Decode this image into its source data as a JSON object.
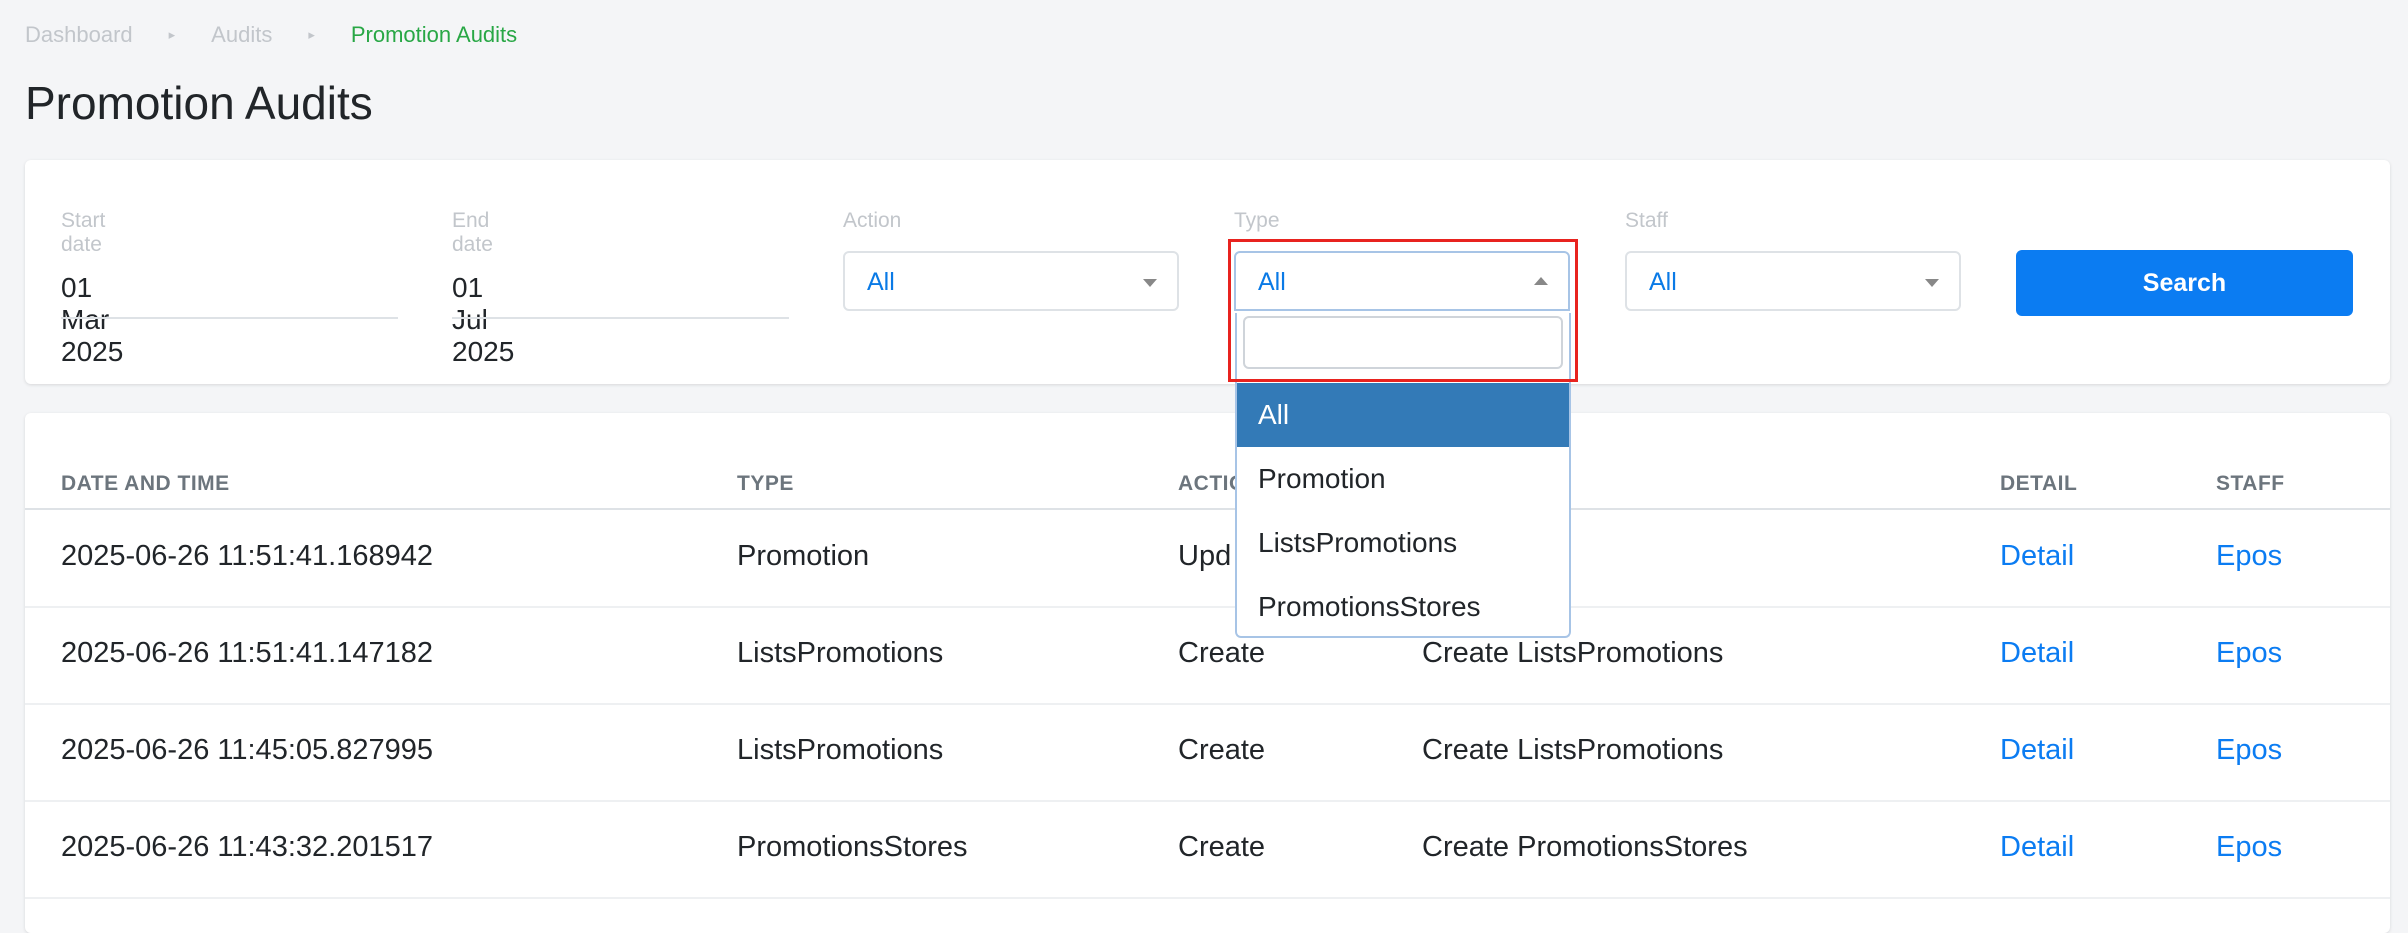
{
  "breadcrumb": {
    "items": [
      "Dashboard",
      "Audits",
      "Promotion Audits"
    ],
    "separator": "▸"
  },
  "page": {
    "title": "Promotion Audits"
  },
  "filters": {
    "start_date": {
      "label": "Start date",
      "value": "01 Mar 2025"
    },
    "end_date": {
      "label": "End date",
      "value": "01 Jul 2025"
    },
    "action": {
      "label": "Action",
      "value": "All"
    },
    "type": {
      "label": "Type",
      "value": "All",
      "open": true,
      "search_value": "",
      "options": [
        "All",
        "Promotion",
        "ListsPromotions",
        "PromotionsStores"
      ],
      "selected_option": "All"
    },
    "staff": {
      "label": "Staff",
      "value": "All"
    },
    "search_button": "Search"
  },
  "table": {
    "headers": {
      "date_time": "DATE AND TIME",
      "type": "TYPE",
      "action": "ACTIO",
      "detail": "DETAIL",
      "staff": "STAFF"
    },
    "rows": [
      {
        "date_time": "2025-06-26 11:51:41.168942",
        "type": "Promotion",
        "action": "Upd",
        "description": "",
        "detail": "Detail",
        "staff": "Epos"
      },
      {
        "date_time": "2025-06-26 11:51:41.147182",
        "type": "ListsPromotions",
        "action": "Create",
        "description": "Create ListsPromotions",
        "detail": "Detail",
        "staff": "Epos"
      },
      {
        "date_time": "2025-06-26 11:45:05.827995",
        "type": "ListsPromotions",
        "action": "Create",
        "description": "Create ListsPromotions",
        "detail": "Detail",
        "staff": "Epos"
      },
      {
        "date_time": "2025-06-26 11:43:32.201517",
        "type": "PromotionsStores",
        "action": "Create",
        "description": "Create PromotionsStores",
        "detail": "Detail",
        "staff": "Epos"
      }
    ]
  },
  "colors": {
    "accent": "#0b7cf2",
    "breadcrumb_active": "#28a745",
    "selected_option": "#337ab7",
    "highlight_border": "#e8231f"
  }
}
